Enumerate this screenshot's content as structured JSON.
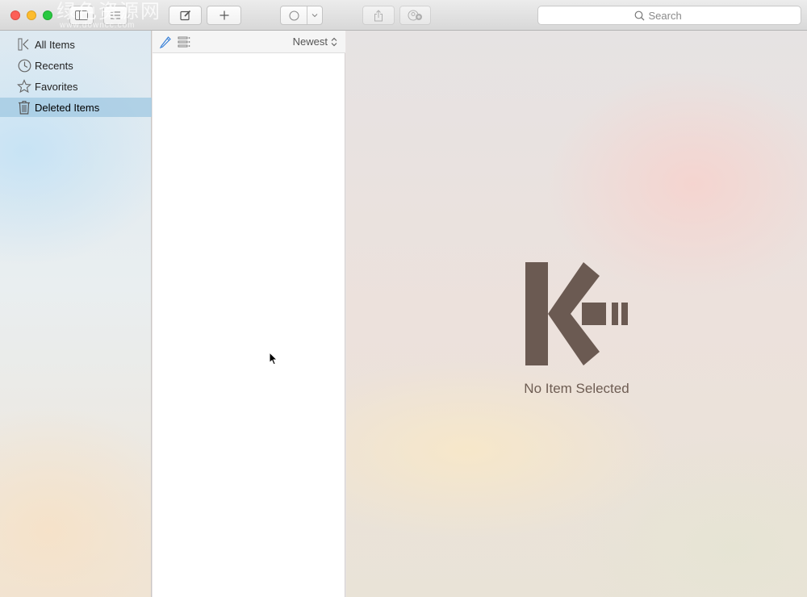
{
  "toolbar": {
    "watermark": "绿色资源网",
    "watermark_url": "www.downcc.com",
    "buttons": [
      {
        "name": "compose",
        "icon": "compose-icon"
      },
      {
        "name": "add",
        "icon": "plus-icon"
      },
      {
        "name": "tag",
        "icon": "circle-icon"
      },
      {
        "name": "share",
        "icon": "share-icon"
      },
      {
        "name": "share-users",
        "icon": "user-add-icon"
      }
    ],
    "search": {
      "placeholder": "Search"
    }
  },
  "sidebar": {
    "items": [
      {
        "label": "All Items",
        "icon": "all-items-icon",
        "selected": false
      },
      {
        "label": "Recents",
        "icon": "clock-icon",
        "selected": false
      },
      {
        "label": "Favorites",
        "icon": "star-icon",
        "selected": false
      },
      {
        "label": "Deleted Items",
        "icon": "trash-icon",
        "selected": true
      }
    ]
  },
  "list": {
    "sort_label": "Newest"
  },
  "detail": {
    "empty_label": "No Item Selected",
    "logo_color": "#6b5a52"
  },
  "colors": {
    "selection": "#a0c8e1",
    "accent_blue": "#3b82d8"
  }
}
